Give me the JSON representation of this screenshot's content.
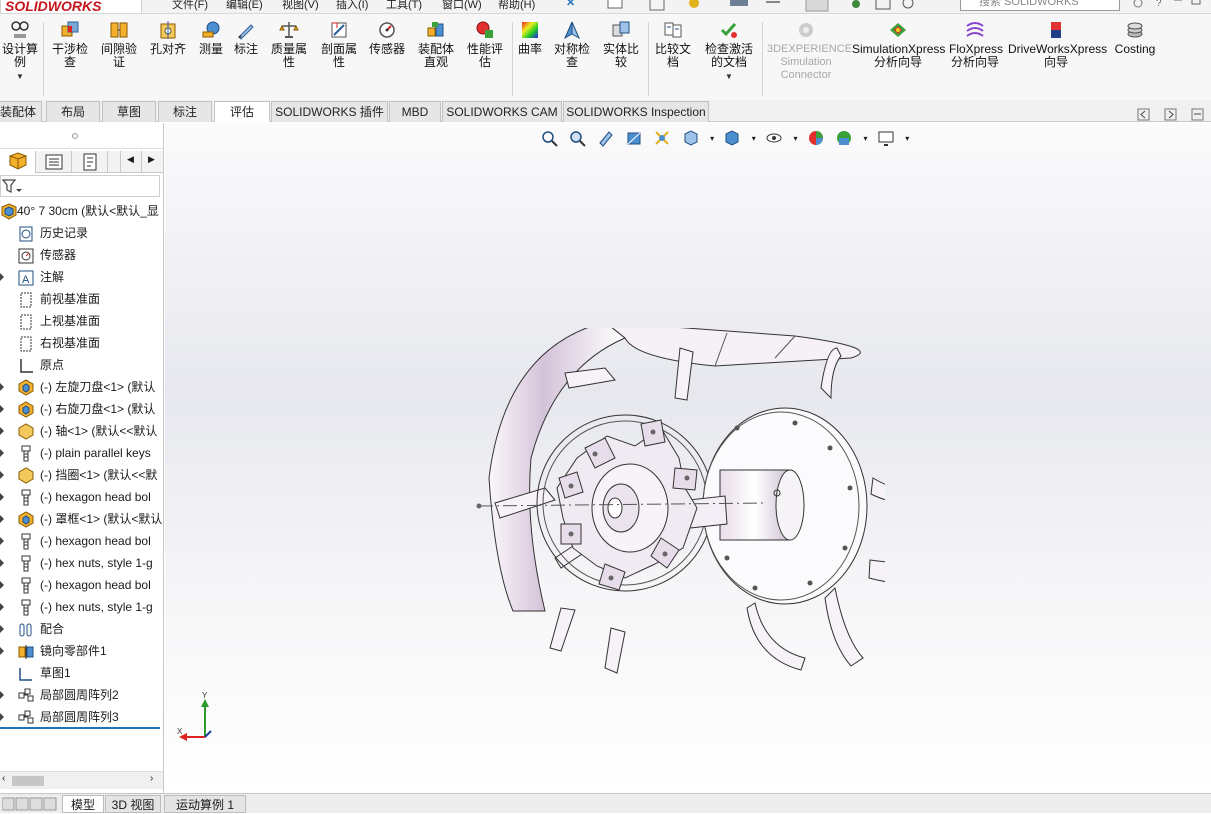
{
  "app": {
    "logo_text": "SOLIDWORKS",
    "menu": [
      "文件(F)",
      "编辑(E)",
      "视图(V)",
      "插入(I)",
      "工具(T)",
      "窗口(W)",
      "帮助(H)"
    ],
    "search_placeholder": "搜索 SOLIDWORKS"
  },
  "commands": {
    "design_study": "设计算例",
    "interference": "干涉检查",
    "clearance": "间隙验证",
    "hole_align": "孔对齐",
    "measure": "测量",
    "markup": "标注",
    "mass_props": "质量属性",
    "section_props": "剖面属性",
    "sensor": "传感器",
    "assembly_visual": "装配体直观",
    "performance": "性能评估",
    "curvature": "曲率",
    "symmetry": "对称检查",
    "compare_solid": "实体比较",
    "compare_doc": "比较文档",
    "check_active": "检查激活的文档",
    "threedx_sim": "3DEXPERIENCE Simulation Connector",
    "simxpress": "SimulationXpress 分析向导",
    "floxpress": "FloXpress 分析向导",
    "driveworks": "DriveWorksXpress 向导",
    "costing": "Costing"
  },
  "tabs": [
    "装配体",
    "布局",
    "草图",
    "标注",
    "评估",
    "SOLIDWORKS 插件",
    "MBD",
    "SOLIDWORKS CAM",
    "SOLIDWORKS Inspection"
  ],
  "active_tab": "评估",
  "tree": {
    "root": "40° 7 30cm  (默认<默认_显",
    "items": [
      {
        "label": "历史记录",
        "icon": "history-icon",
        "expandable": false
      },
      {
        "label": "传感器",
        "icon": "sensor-icon",
        "expandable": false
      },
      {
        "label": "注解",
        "icon": "annotation-icon",
        "expandable": true
      },
      {
        "label": "前视基准面",
        "icon": "plane-icon",
        "expandable": false
      },
      {
        "label": "上视基准面",
        "icon": "plane-icon",
        "expandable": false
      },
      {
        "label": "右视基准面",
        "icon": "plane-icon",
        "expandable": false
      },
      {
        "label": "原点",
        "icon": "origin-icon",
        "expandable": false
      },
      {
        "label": "(-) 左旋刀盘<1> (默认",
        "icon": "assembly-icon",
        "expandable": true
      },
      {
        "label": "(-) 右旋刀盘<1> (默认",
        "icon": "assembly-icon",
        "expandable": true
      },
      {
        "label": "(-) 轴<1> (默认<<默认",
        "icon": "part-icon",
        "expandable": true
      },
      {
        "label": "(-) plain parallel keys",
        "icon": "fastener-icon",
        "expandable": true
      },
      {
        "label": "(-) 挡圈<1> (默认<<默",
        "icon": "part-icon",
        "expandable": true
      },
      {
        "label": "(-) hexagon head bol",
        "icon": "fastener-icon",
        "expandable": true
      },
      {
        "label": "(-) 罩框<1> (默认<默认",
        "icon": "assembly-icon",
        "expandable": true
      },
      {
        "label": "(-) hexagon head bol",
        "icon": "fastener-icon",
        "expandable": true
      },
      {
        "label": "(-) hex nuts, style 1-g",
        "icon": "fastener-icon",
        "expandable": true
      },
      {
        "label": "(-) hexagon head bol",
        "icon": "fastener-icon",
        "expandable": true
      },
      {
        "label": "(-) hex nuts, style 1-g",
        "icon": "fastener-icon",
        "expandable": true
      },
      {
        "label": "配合",
        "icon": "mate-icon",
        "expandable": true
      },
      {
        "label": "镜向零部件1",
        "icon": "mirror-icon",
        "expandable": true
      },
      {
        "label": "草图1",
        "icon": "sketch-icon",
        "expandable": false
      },
      {
        "label": "局部圆周阵列2",
        "icon": "pattern-icon",
        "expandable": true
      },
      {
        "label": "局部圆周阵列3",
        "icon": "pattern-icon",
        "expandable": true
      }
    ]
  },
  "bottom_tabs": [
    "模型",
    "3D 视图",
    "运动算例 1"
  ],
  "active_bottom_tab": "模型",
  "triad": {
    "y_label": "Y",
    "x_label": "X"
  },
  "colors": {
    "brand": "#c4161c",
    "accent_blue": "#1e73be"
  }
}
